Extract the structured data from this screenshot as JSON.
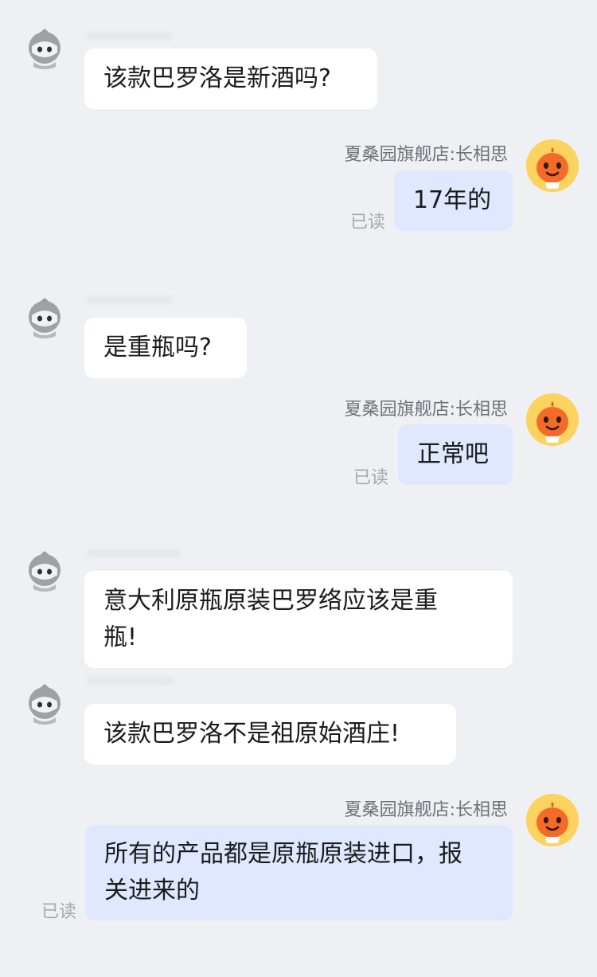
{
  "conversation": {
    "messages": [
      {
        "side": "customer",
        "text": "该款巴罗洛是新酒吗?"
      },
      {
        "side": "shop",
        "sender": "夏桑园旗舰店:长相思",
        "text": "17年的",
        "status": "已读"
      },
      {
        "side": "customer",
        "text": "是重瓶吗?"
      },
      {
        "side": "shop",
        "sender": "夏桑园旗舰店:长相思",
        "text": "正常吧",
        "status": "已读"
      },
      {
        "side": "customer",
        "text": "意大利原瓶原装巴罗络应该是重\n瓶!"
      },
      {
        "side": "customer",
        "text": "该款巴罗洛不是祖原始酒庄!"
      },
      {
        "side": "shop",
        "sender": "夏桑园旗舰店:长相思",
        "text": "所有的产品都是原瓶原装进口，报\n关进来的",
        "status": "已读"
      }
    ]
  },
  "theme": {
    "background": "#eff0f4",
    "customer_bubble": "#ffffff",
    "shop_bubble": "#dfe8fe",
    "shop_avatar_bg": "#fbd35e",
    "shop_avatar_face": "#f46a2a"
  }
}
